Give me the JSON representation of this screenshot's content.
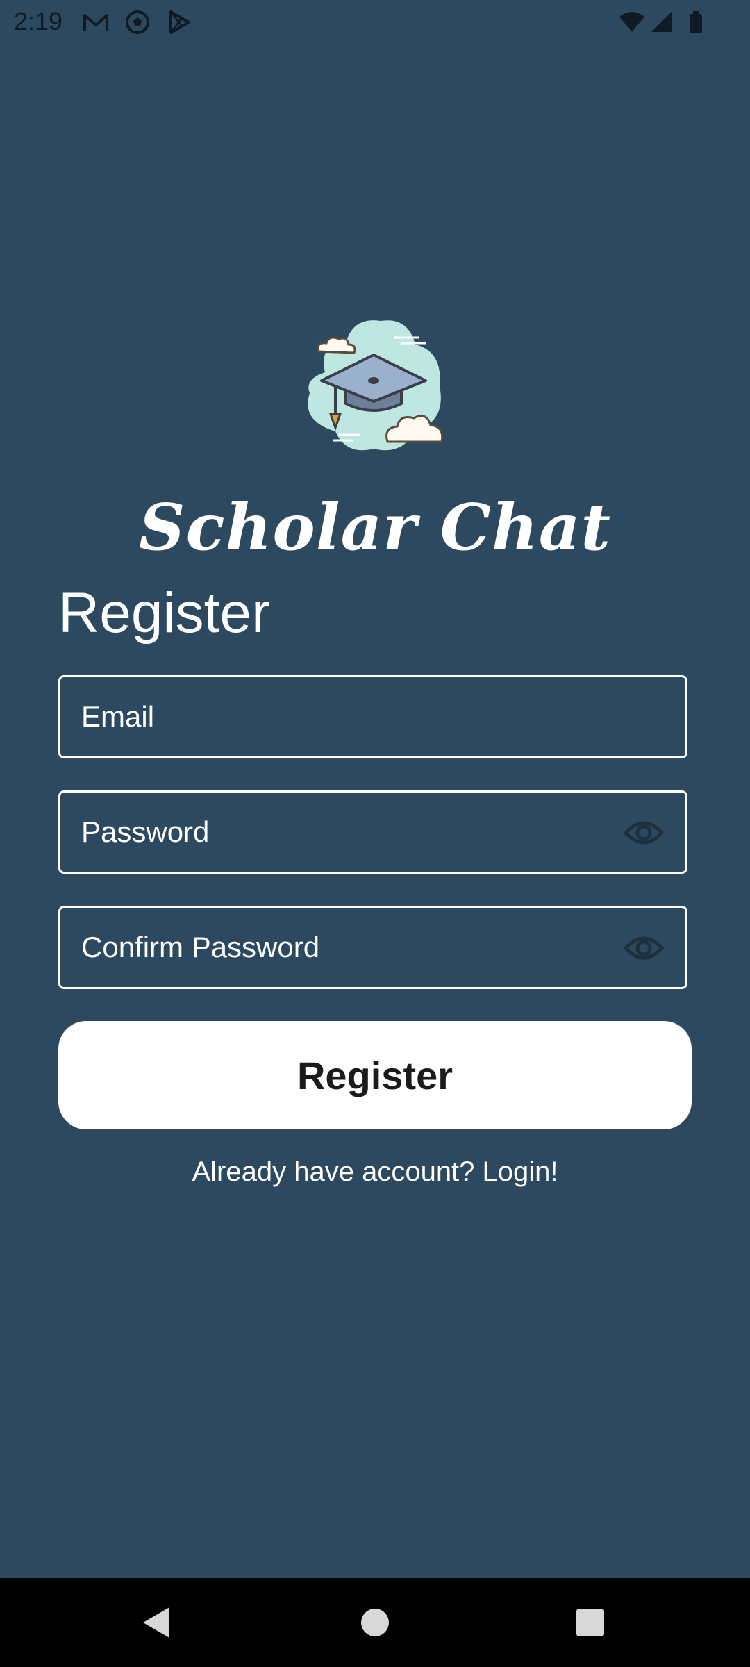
{
  "status_bar": {
    "time": "2:19",
    "left_icons": [
      "gmail-icon",
      "soccer-ball-icon",
      "play-store-icon"
    ],
    "right_icons": [
      "wifi-icon",
      "signal-icon",
      "battery-icon"
    ]
  },
  "app": {
    "title": "Scholar Chat",
    "logo": "graduation-cap-logo"
  },
  "form": {
    "heading": "Register",
    "email_placeholder": "Email",
    "password_placeholder": "Password",
    "confirm_password_placeholder": "Confirm Password",
    "submit_label": "Register",
    "login_link": "Already have account? Login!"
  },
  "colors": {
    "background": "#2d4960",
    "button_background": "#ffffff",
    "button_text": "#1b1b1b",
    "text": "#ffffff"
  },
  "nav_bar": {
    "buttons": [
      "back-icon",
      "home-icon",
      "recents-icon"
    ]
  }
}
